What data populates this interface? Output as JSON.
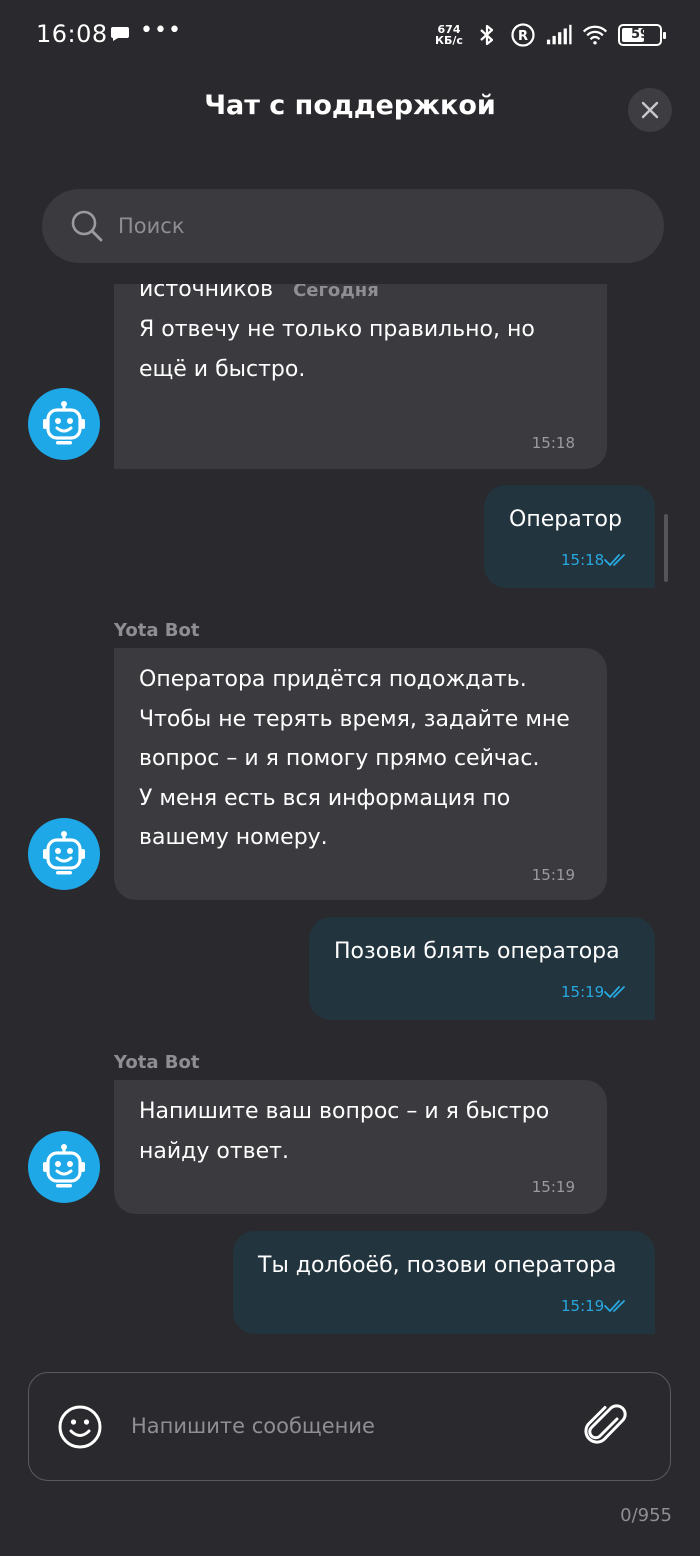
{
  "status_bar": {
    "time": "16:08",
    "net_speed_value": "674",
    "net_speed_unit": "КБ/с",
    "battery": "59"
  },
  "header": {
    "title": "Чат с поддержкой"
  },
  "search": {
    "placeholder": "Поиск"
  },
  "messages": [
    {
      "direction": "incoming",
      "text_before_date": "оператором берем из одних\nисточников",
      "date_label": "Сегодня",
      "text_after_date": "Я отвечу не только правильно, но\nещё и быстро.",
      "time": "15:18"
    },
    {
      "direction": "outgoing",
      "text": "Оператор",
      "time": "15:18"
    },
    {
      "direction": "incoming",
      "sender": "Yota Bot",
      "text": "Оператора придётся подождать.\nЧтобы не терять время, задайте мне\nвопрос – и я помогу прямо сейчас.\nУ меня есть вся информация по\nвашему номеру.",
      "time": "15:19"
    },
    {
      "direction": "outgoing",
      "text": "Позови блять оператора",
      "time": "15:19"
    },
    {
      "direction": "incoming",
      "sender": "Yota Bot",
      "text": "Напишите ваш вопрос – и я быстро\nнайду ответ.",
      "time": "15:19"
    },
    {
      "direction": "outgoing",
      "text": "Ты долбоёб, позови оператора",
      "time": "15:19"
    }
  ],
  "composer": {
    "placeholder": "Напишите сообщение",
    "counter": "0/955"
  },
  "colors": {
    "background": "#2a2a2e",
    "incoming_bubble": "#3a3a3f",
    "outgoing_bubble": "#22343e",
    "bot_avatar": "#1ea8e8",
    "read_check": "#29a8e0"
  },
  "icons": {
    "close": "close-icon",
    "search": "search-icon",
    "emoji": "smiley-icon",
    "attach": "paperclip-icon",
    "bot_avatar": "robot-icon",
    "read_status": "double-check-icon"
  }
}
